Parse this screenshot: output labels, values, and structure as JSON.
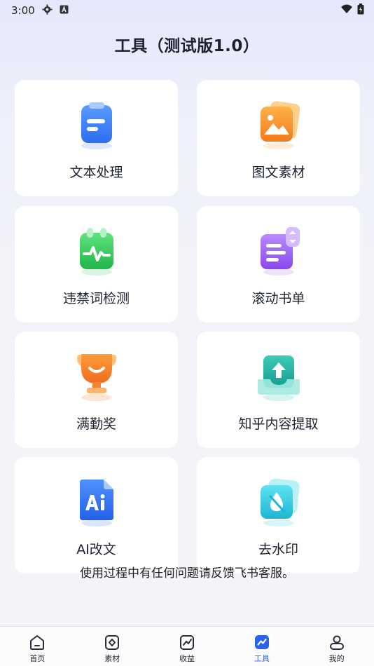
{
  "status_bar": {
    "time": "3:00"
  },
  "page_title": "工具（测试版1.0）",
  "tools": [
    {
      "label": "文本处理",
      "icon": "document-text-icon",
      "color": "#3a7cf6"
    },
    {
      "label": "图文素材",
      "icon": "image-icon",
      "color": "#f7962a"
    },
    {
      "label": "违禁词检测",
      "icon": "pulse-check-icon",
      "color": "#2fc95a"
    },
    {
      "label": "滚动书单",
      "icon": "scroll-list-icon",
      "color": "#9b5cf2"
    },
    {
      "label": "满勤奖",
      "icon": "trophy-icon",
      "color": "#f57a2c"
    },
    {
      "label": "知乎内容提取",
      "icon": "upload-tray-icon",
      "color": "#21b5a6"
    },
    {
      "label": "AI改文",
      "icon": "ai-file-icon",
      "color": "#2f74f0"
    },
    {
      "label": "去水印",
      "icon": "water-drop-icon",
      "color": "#27c6dc"
    }
  ],
  "footer_note": "使用过程中有任何问题请反馈飞书客服。",
  "tabbar": {
    "items": [
      {
        "label": "首页",
        "icon": "home-icon"
      },
      {
        "label": "素材",
        "icon": "material-icon"
      },
      {
        "label": "收益",
        "icon": "earnings-chart-icon"
      },
      {
        "label": "工具",
        "icon": "tools-icon",
        "active": true
      },
      {
        "label": "我的",
        "icon": "profile-icon"
      }
    ],
    "active_color": "#2a62f0"
  }
}
